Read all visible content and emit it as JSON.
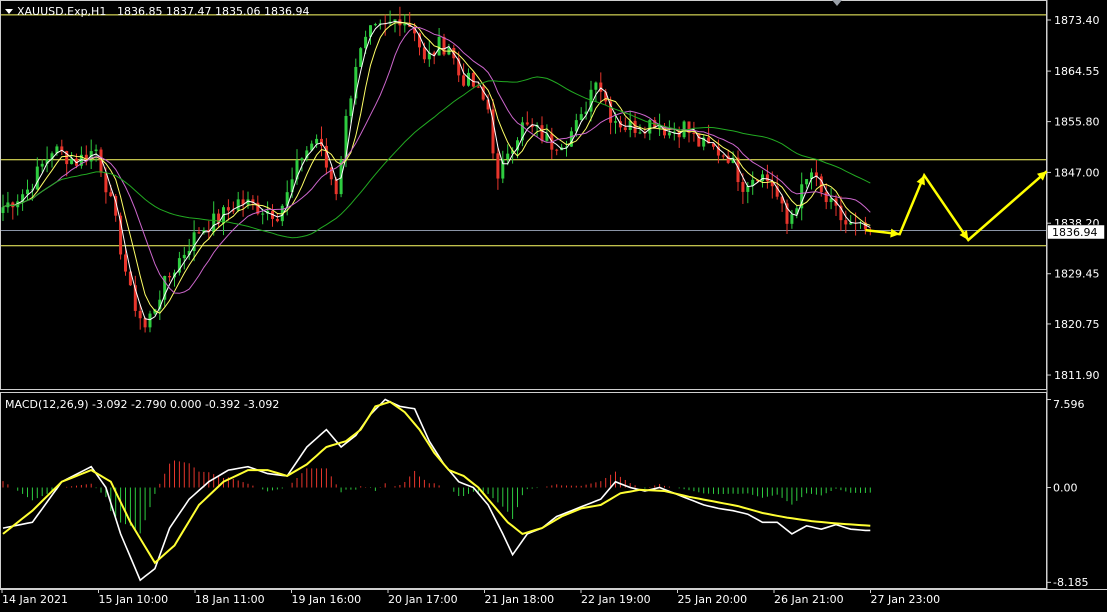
{
  "window": {
    "symbol_info": "XAUUSD.Exp,H1",
    "ohlc": "1836.85 1837.47 1835.06 1836.94",
    "current_price": "1836.94"
  },
  "chart_data": [
    {
      "type": "candlestick",
      "title": "XAUUSD.Exp,H1",
      "price_ticks": [
        "1873.40",
        "1864.55",
        "1855.80",
        "1847.00",
        "1838.20",
        "1829.45",
        "1820.75",
        "1811.90"
      ],
      "price_tick_values": [
        1873.4,
        1864.55,
        1855.8,
        1847.0,
        1838.2,
        1829.45,
        1820.75,
        1811.9
      ],
      "ylim": [
        1810,
        1876
      ],
      "time_ticks": [
        "14 Jan 2021",
        "15 Jan 10:00",
        "18 Jan 11:00",
        "19 Jan 16:00",
        "20 Jan 17:00",
        "21 Jan 18:00",
        "22 Jan 19:00",
        "25 Jan 20:00",
        "26 Jan 21:00",
        "27 Jan 23:00"
      ],
      "horizontal_lines": [
        {
          "value": 1874.3,
          "color": "#ffff66"
        },
        {
          "value": 1849.2,
          "color": "#ffff66"
        },
        {
          "value": 1836.94,
          "color": "#8a94a6"
        },
        {
          "value": 1834.3,
          "color": "#ffff66"
        }
      ],
      "close_path_anchors": [
        [
          0,
          1841
        ],
        [
          5,
          1844
        ],
        [
          10,
          1851
        ],
        [
          15,
          1849
        ],
        [
          19,
          1851
        ],
        [
          21,
          1845
        ],
        [
          23,
          1838
        ],
        [
          26,
          1826
        ],
        [
          29,
          1820
        ],
        [
          32,
          1826
        ],
        [
          36,
          1832
        ],
        [
          40,
          1837
        ],
        [
          44,
          1839
        ],
        [
          48,
          1842
        ],
        [
          52,
          1841
        ],
        [
          56,
          1840
        ],
        [
          58,
          1843
        ],
        [
          61,
          1850
        ],
        [
          64,
          1853
        ],
        [
          66,
          1848
        ],
        [
          68,
          1844
        ],
        [
          70,
          1856
        ],
        [
          72,
          1866
        ],
        [
          75,
          1871
        ],
        [
          78,
          1872
        ],
        [
          81,
          1874
        ],
        [
          84,
          1872
        ],
        [
          86,
          1866
        ],
        [
          89,
          1869
        ],
        [
          91,
          1869
        ],
        [
          93,
          1864
        ],
        [
          96,
          1862
        ],
        [
          99,
          1858
        ],
        [
          101,
          1845
        ],
        [
          103,
          1851
        ],
        [
          106,
          1855
        ],
        [
          109,
          1854
        ],
        [
          112,
          1852
        ],
        [
          115,
          1853
        ],
        [
          118,
          1856
        ],
        [
          121,
          1864
        ],
        [
          124,
          1857
        ],
        [
          127,
          1855
        ],
        [
          130,
          1855
        ],
        [
          133,
          1856
        ],
        [
          136,
          1854
        ],
        [
          139,
          1855
        ],
        [
          142,
          1852
        ],
        [
          145,
          1851
        ],
        [
          148,
          1850
        ],
        [
          151,
          1845
        ],
        [
          154,
          1847
        ],
        [
          157,
          1845
        ],
        [
          160,
          1838
        ],
        [
          162,
          1842
        ],
        [
          165,
          1847
        ],
        [
          167,
          1843
        ],
        [
          169,
          1841
        ],
        [
          172,
          1838
        ],
        [
          175,
          1837
        ],
        [
          177,
          1836.9
        ]
      ],
      "colors": {
        "bull": "#2ecc40",
        "bear": "#e8352c",
        "ma_fast": "#ffffff",
        "ma_yellow": "#ffff66",
        "ma_violet": "#cc66cc",
        "ma_slow": "#22aa22",
        "arrow": "#ffff00"
      },
      "forecast_arrow": [
        [
          176,
          1837.0
        ],
        [
          183,
          1836.3
        ],
        [
          188,
          1846.5
        ],
        [
          197,
          1835.3
        ],
        [
          213,
          1847.2
        ]
      ]
    },
    {
      "type": "macd",
      "title": "MACD(12,26,9) -3.092 -2.790 0.000 -0.392 -3.092",
      "ticks": [
        "7.596",
        "0.00",
        "-8.185"
      ],
      "tick_values": [
        7.596,
        0.0,
        -8.185
      ],
      "ylim": [
        -8.5,
        7.9
      ],
      "macd_anchors": [
        [
          0,
          -3.5
        ],
        [
          6,
          -3.0
        ],
        [
          12,
          0.5
        ],
        [
          18,
          1.8
        ],
        [
          21,
          0.0
        ],
        [
          24,
          -4.0
        ],
        [
          28,
          -8.0
        ],
        [
          31,
          -7.0
        ],
        [
          34,
          -3.5
        ],
        [
          38,
          -1.0
        ],
        [
          42,
          0.5
        ],
        [
          46,
          1.5
        ],
        [
          50,
          1.8
        ],
        [
          54,
          1.2
        ],
        [
          58,
          1.0
        ],
        [
          62,
          3.5
        ],
        [
          66,
          5.0
        ],
        [
          69,
          3.5
        ],
        [
          72,
          4.5
        ],
        [
          75,
          6.3
        ],
        [
          78,
          7.6
        ],
        [
          81,
          7.0
        ],
        [
          84,
          6.8
        ],
        [
          87,
          4.0
        ],
        [
          90,
          2.0
        ],
        [
          93,
          0.5
        ],
        [
          96,
          0.0
        ],
        [
          99,
          -1.5
        ],
        [
          102,
          -4.0
        ],
        [
          104,
          -5.8
        ],
        [
          107,
          -4.0
        ],
        [
          110,
          -3.5
        ],
        [
          113,
          -2.5
        ],
        [
          116,
          -2.0
        ],
        [
          119,
          -1.5
        ],
        [
          122,
          -1.0
        ],
        [
          125,
          0.5
        ],
        [
          128,
          0.0
        ],
        [
          131,
          -0.3
        ],
        [
          134,
          0.0
        ],
        [
          137,
          -0.5
        ],
        [
          140,
          -1.0
        ],
        [
          143,
          -1.5
        ],
        [
          146,
          -1.8
        ],
        [
          149,
          -2.0
        ],
        [
          152,
          -2.3
        ],
        [
          155,
          -3.0
        ],
        [
          158,
          -3.0
        ],
        [
          161,
          -4.0
        ],
        [
          164,
          -3.3
        ],
        [
          167,
          -3.6
        ],
        [
          170,
          -3.2
        ],
        [
          173,
          -3.6
        ],
        [
          176,
          -3.7
        ],
        [
          177,
          -3.7
        ]
      ],
      "signal_anchors": [
        [
          0,
          -4.0
        ],
        [
          6,
          -2.0
        ],
        [
          12,
          0.5
        ],
        [
          18,
          1.5
        ],
        [
          22,
          0.5
        ],
        [
          26,
          -3.0
        ],
        [
          31,
          -6.5
        ],
        [
          35,
          -5.0
        ],
        [
          40,
          -1.5
        ],
        [
          45,
          0.5
        ],
        [
          50,
          1.5
        ],
        [
          54,
          1.5
        ],
        [
          58,
          1.0
        ],
        [
          62,
          2.0
        ],
        [
          66,
          3.5
        ],
        [
          70,
          4.0
        ],
        [
          73,
          5.0
        ],
        [
          76,
          7.0
        ],
        [
          79,
          7.4
        ],
        [
          82,
          6.5
        ],
        [
          85,
          5.0
        ],
        [
          88,
          3.0
        ],
        [
          91,
          1.5
        ],
        [
          94,
          1.0
        ],
        [
          97,
          0.0
        ],
        [
          100,
          -1.5
        ],
        [
          103,
          -3.0
        ],
        [
          106,
          -4.0
        ],
        [
          110,
          -3.5
        ],
        [
          114,
          -2.5
        ],
        [
          118,
          -1.8
        ],
        [
          122,
          -1.5
        ],
        [
          126,
          -0.5
        ],
        [
          130,
          -0.2
        ],
        [
          135,
          -0.3
        ],
        [
          140,
          -0.8
        ],
        [
          145,
          -1.2
        ],
        [
          150,
          -1.6
        ],
        [
          155,
          -2.2
        ],
        [
          160,
          -2.6
        ],
        [
          165,
          -2.9
        ],
        [
          170,
          -3.1
        ],
        [
          177,
          -3.3
        ]
      ],
      "colors": {
        "macd": "#ffffff",
        "signal": "#ffff33",
        "hist_up": "#e8352c",
        "hist_down": "#2ecc40"
      }
    }
  ]
}
